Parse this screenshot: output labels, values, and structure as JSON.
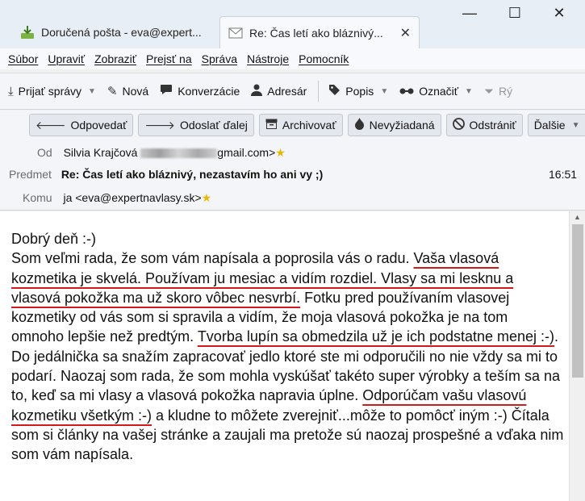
{
  "window": {
    "tabs": [
      {
        "label": "Doručená pošta - eva@expert...",
        "icon": "inbox-download-icon"
      },
      {
        "label": "Re: Čas letí ako bláznivý...",
        "icon": "envelope-icon"
      }
    ],
    "controls": {
      "minimize": "—",
      "maximize": "☐",
      "close": "✕"
    }
  },
  "menu": [
    "Súbor",
    "Upraviť",
    "Zobraziť",
    "Prejsť na",
    "Správa",
    "Nástroje",
    "Pomocník"
  ],
  "toolbar": {
    "get_messages": "Prijať správy",
    "new": "Nová",
    "chat": "Konverzácie",
    "address_book": "Adresár",
    "tag": "Popis",
    "mark": "Označiť",
    "filter_partial": "Rý"
  },
  "actions": {
    "reply": "Odpovedať",
    "forward": "Odoslať ďalej",
    "archive": "Archivovať",
    "junk": "Nevyžiadaná",
    "delete": "Odstrániť",
    "more": "Ďalšie"
  },
  "header": {
    "from_label": "Od",
    "from_name": "Silvia Krajčová",
    "from_email_suffix": "gmail.com>",
    "subject_label": "Predmet",
    "subject": "Re: Čas letí ako bláznivý, nezastavím ho ani vy ;)",
    "time": "16:51",
    "to_label": "Komu",
    "to": "ja <eva@expertnavlasy.sk>"
  },
  "body": {
    "greeting": "Dobrý deň :-)",
    "s1": "Som veľmi rada, že som vám napísala a poprosila vás o radu. ",
    "s2": "Vaša vlasová kozmetika je skvelá. Používam ju mesiac a vidím rozdiel. Vlasy sa mi lesknu a vlasová pokožka ma už skoro vôbec nesvrbí.",
    "s3": " Fotku pred používaním vlasovej kozmetiky od vás som si spravila a vidím, že moja vlasová pokožka je na tom omnoho lepšie než predtým. ",
    "s4": "Tvorba lupín sa obmedzila už je ich podstatne menej :-)",
    "s5": ". Do jedálnička sa snažím zapracovať jedlo ktoré ste mi odporučili no nie vždy sa mi to podarí. Naozaj som rada, že som mohla vyskúšať takéto super výrobky a teším sa na to, keď sa mi vlasy a vlasová pokožka  napravia úplne. ",
    "s6": "Odporúčam vašu vlasovú kozmetiku všetkým :-)",
    "s7": " a kludne to môžete zverejniť...môže to pomôcť iným :-) Čítala som si články na vašej stránke a zaujali ma pretože sú naozaj prospešné a vďaka nim som vám napísala."
  },
  "colors": {
    "underline": "#d21a1a",
    "star": "#e8b800"
  }
}
